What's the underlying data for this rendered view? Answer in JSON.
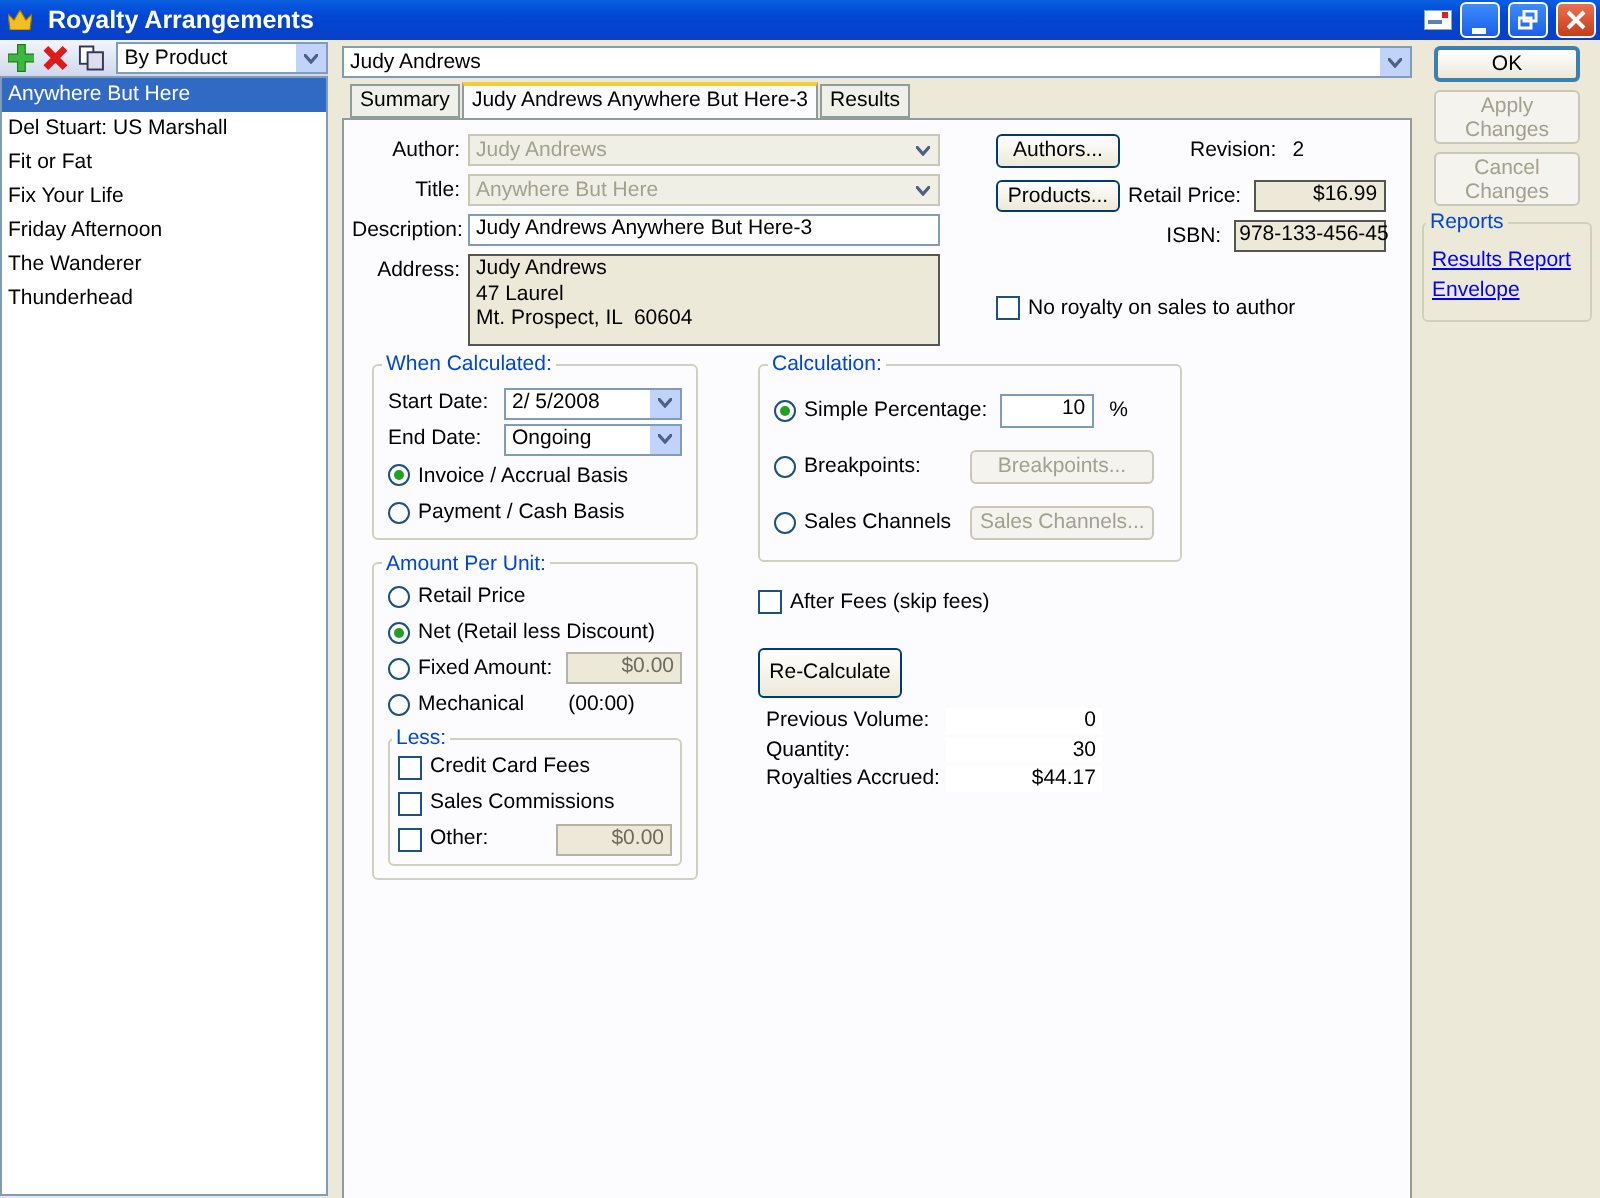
{
  "window": {
    "title": "Royalty Arrangements"
  },
  "sidebar": {
    "filter": "By Product",
    "items": [
      {
        "label": "Anywhere But Here",
        "selected": true
      },
      {
        "label": "Del Stuart: US Marshall",
        "selected": false
      },
      {
        "label": "Fit or Fat",
        "selected": false
      },
      {
        "label": "Fix Your Life",
        "selected": false
      },
      {
        "label": "Friday Afternoon",
        "selected": false
      },
      {
        "label": "The Wanderer",
        "selected": false
      },
      {
        "label": "Thunderhead",
        "selected": false
      }
    ]
  },
  "record_selector": "Judy Andrews",
  "tabs": [
    {
      "label": "Summary",
      "selected": false
    },
    {
      "label": "Judy Andrews Anywhere But Here-3",
      "selected": true
    },
    {
      "label": "Results",
      "selected": false
    }
  ],
  "form": {
    "author": {
      "label": "Author:",
      "value": "Judy Andrews",
      "disabled": true
    },
    "title": {
      "label": "Title:",
      "value": "Anywhere But Here",
      "disabled": true
    },
    "description": {
      "label": "Description:",
      "value": "Judy Andrews Anywhere But Here-3"
    },
    "address": {
      "label": "Address:",
      "lines": [
        "Judy Andrews",
        "47 Laurel",
        "Mt. Prospect, IL  60604"
      ]
    },
    "authors_button": "Authors...",
    "products_button": "Products...",
    "revision": {
      "label": "Revision:",
      "value": "2"
    },
    "retail_price": {
      "label": "Retail Price:",
      "value": "$16.99"
    },
    "isbn": {
      "label": "ISBN:",
      "value": "978-133-456-45"
    },
    "no_royalty": {
      "label": "No royalty on sales to author",
      "checked": false
    }
  },
  "when_calculated": {
    "title": "When Calculated:",
    "start_date": {
      "label": "Start Date:",
      "value": "2/  5/2008"
    },
    "end_date": {
      "label": "End Date:",
      "value": "Ongoing"
    },
    "options": [
      {
        "label": "Invoice / Accrual Basis",
        "selected": true
      },
      {
        "label": "Payment / Cash Basis",
        "selected": false
      }
    ]
  },
  "amount_per_unit": {
    "title": "Amount Per Unit:",
    "options": [
      {
        "kind": "plain",
        "label": "Retail Price",
        "selected": false
      },
      {
        "kind": "plain",
        "label": "Net (Retail less Discount)",
        "selected": true
      },
      {
        "kind": "field",
        "label": "Fixed Amount:",
        "selected": false,
        "value": "$0.00"
      },
      {
        "kind": "note",
        "label": "Mechanical",
        "selected": false,
        "note": "(00:00)"
      }
    ],
    "less": {
      "title": "Less:",
      "items": [
        {
          "kind": "plain",
          "label": "Credit Card Fees",
          "checked": false
        },
        {
          "kind": "plain",
          "label": "Sales Commissions",
          "checked": false
        },
        {
          "kind": "field",
          "label": "Other:",
          "checked": false,
          "value": "$0.00"
        }
      ]
    }
  },
  "calculation": {
    "title": "Calculation:",
    "options": [
      {
        "kind": "input",
        "label": "Simple Percentage:",
        "selected": true,
        "value": "10",
        "unit": "%"
      },
      {
        "kind": "button",
        "label": "Breakpoints:",
        "selected": false,
        "button": "Breakpoints..."
      },
      {
        "kind": "button",
        "label": "Sales Channels",
        "selected": false,
        "button": "Sales Channels..."
      }
    ]
  },
  "after_fees": {
    "label": "After Fees (skip fees)",
    "checked": false
  },
  "recalculate_button": "Re-Calculate",
  "totals": [
    {
      "label": "Previous Volume:",
      "value": "0"
    },
    {
      "label": "Quantity:",
      "value": "30"
    },
    {
      "label": "Royalties Accrued:",
      "value": "$44.17"
    }
  ],
  "actions": [
    {
      "label": "OK",
      "disabled": false
    },
    {
      "label": "Apply Changes",
      "disabled": true
    },
    {
      "label": "Cancel Changes",
      "disabled": true
    }
  ],
  "reports": {
    "title": "Reports",
    "links": [
      "Results Report",
      "Envelope"
    ]
  }
}
